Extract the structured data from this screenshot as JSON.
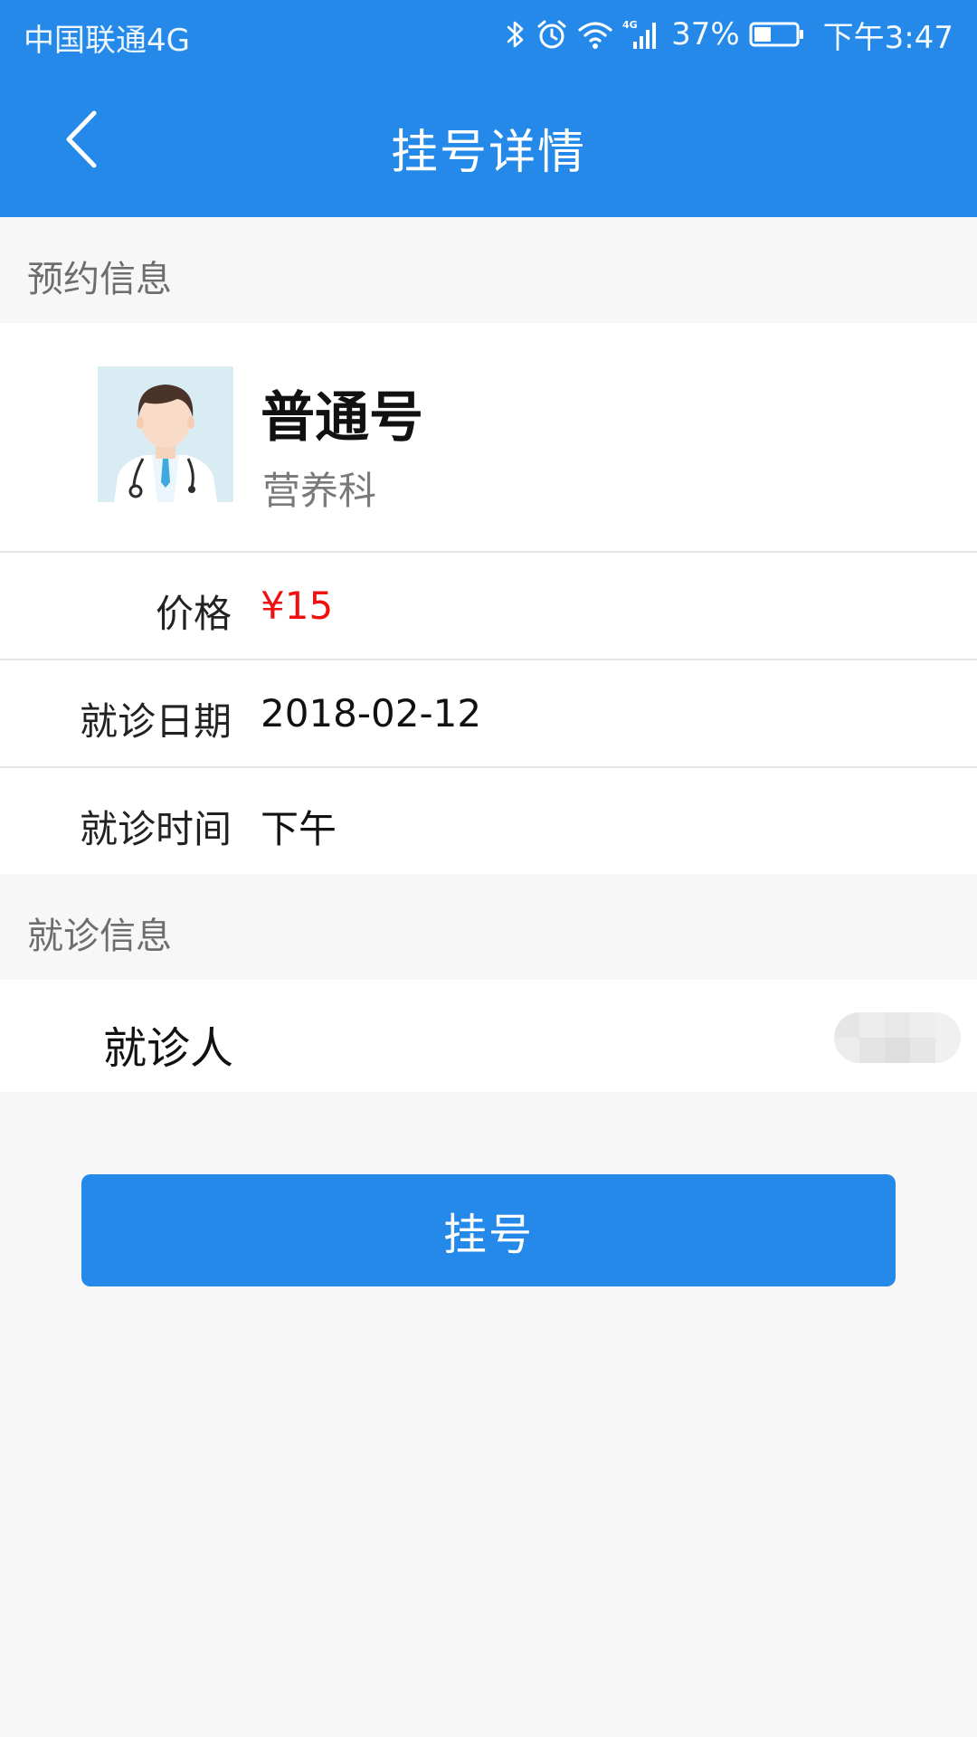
{
  "status_bar": {
    "carrier": "中国联通4G",
    "battery_percent": "37%",
    "time": "下午3:47",
    "icons": [
      "bluetooth-icon",
      "alarm-icon",
      "wifi-icon",
      "signal-4g-icon",
      "battery-icon"
    ]
  },
  "header": {
    "title": "挂号详情",
    "back_icon": "chevron-left-icon"
  },
  "sections": {
    "appointment_header": "预约信息",
    "visit_header": "就诊信息"
  },
  "doctor": {
    "type": "普通号",
    "department": "营养科",
    "avatar_icon": "doctor-avatar-icon"
  },
  "appointment": {
    "price_label": "价格",
    "price_value": "¥15",
    "date_label": "就诊日期",
    "date_value": "2018-02-12",
    "time_label": "就诊时间",
    "time_value": "下午"
  },
  "patient": {
    "label": "就诊人"
  },
  "actions": {
    "register_label": "挂号"
  },
  "colors": {
    "primary": "#2489e8",
    "price": "#f01010",
    "background": "#f7f7f7"
  }
}
